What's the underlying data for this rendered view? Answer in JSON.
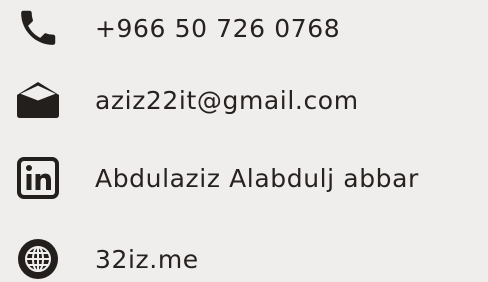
{
  "contacts": {
    "phone": {
      "icon": "phone-icon",
      "label": "+966 50 726 0768"
    },
    "email": {
      "icon": "envelope-icon",
      "label": "aziz22it@gmail.com"
    },
    "linkedin": {
      "icon": "linkedin-icon",
      "label": "Abdulaziz Alabdulj abbar"
    },
    "website": {
      "icon": "globe-icon",
      "label": "32iz.me"
    }
  },
  "colors": {
    "background": "#f0eeec",
    "text": "#27221f",
    "icon": "#231f1d"
  }
}
